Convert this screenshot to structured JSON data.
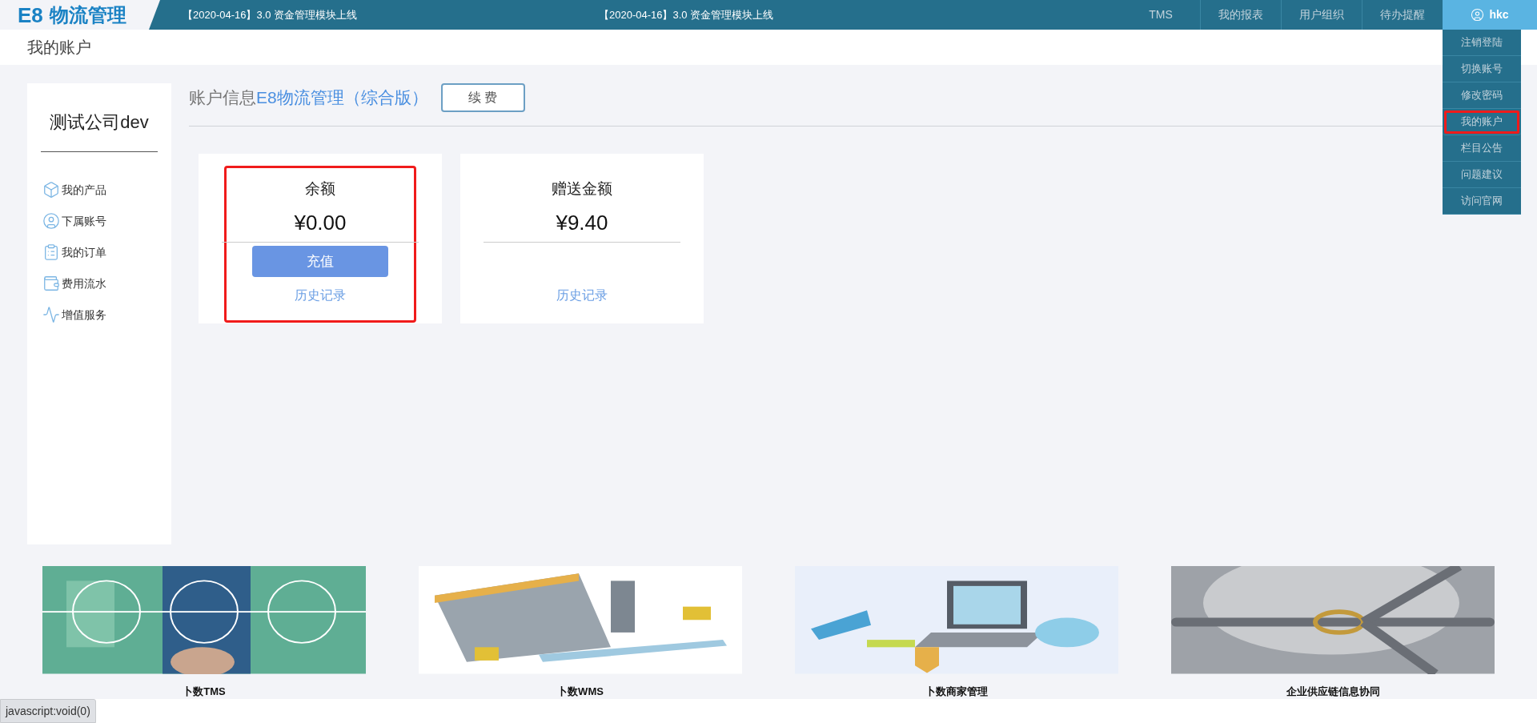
{
  "header": {
    "logo": {
      "mark": "E8",
      "name": "物流管理"
    },
    "notices": [
      "【2020-04-16】3.0 资金管理模块上线",
      "【2020-04-16】3.0 资金管理模块上线"
    ],
    "nav": [
      {
        "label": "TMS",
        "selected": false
      },
      {
        "label": "我的报表",
        "selected": false
      },
      {
        "label": "用户组织",
        "selected": false
      },
      {
        "label": "待办提醒",
        "selected": false
      }
    ],
    "user": {
      "name": "hkc",
      "expanded": true
    },
    "user_menu": [
      {
        "label": "注销登陆",
        "highlighted": false
      },
      {
        "label": "切换账号",
        "highlighted": false
      },
      {
        "label": "修改密码",
        "highlighted": false
      },
      {
        "label": "我的账户",
        "highlighted": true
      },
      {
        "label": "栏目公告",
        "highlighted": false
      },
      {
        "label": "问题建议",
        "highlighted": false
      },
      {
        "label": "访问官网",
        "highlighted": false
      }
    ]
  },
  "page_title": "我的账户",
  "sidebar": {
    "company": "测试公司dev",
    "items": [
      {
        "kind": "product",
        "label": "我的产品"
      },
      {
        "kind": "subaccount",
        "label": "下属账号"
      },
      {
        "kind": "orders",
        "label": "我的订单"
      },
      {
        "kind": "billing",
        "label": "费用流水"
      },
      {
        "kind": "services",
        "label": "增值服务"
      }
    ]
  },
  "account": {
    "heading": "账户信息",
    "product": "E8物流管理（综合版）",
    "renew_button": "续 费",
    "cards": [
      {
        "title": "余额",
        "amount": "¥0.00",
        "button": "充值",
        "link": "历史记录",
        "highlighted": true
      },
      {
        "title": "赠送金额",
        "amount": "¥9.40",
        "link": "历史记录",
        "highlighted": false
      }
    ]
  },
  "promos": [
    {
      "kind": "picture",
      "label": "卜数TMS"
    },
    {
      "kind": "picture",
      "label": "卜数WMS"
    },
    {
      "kind": "picture",
      "label": "卜数商家管理"
    },
    {
      "kind": "picture",
      "label": "企业供应链信息协同"
    }
  ],
  "status_bar": "javascript:void(0)"
}
